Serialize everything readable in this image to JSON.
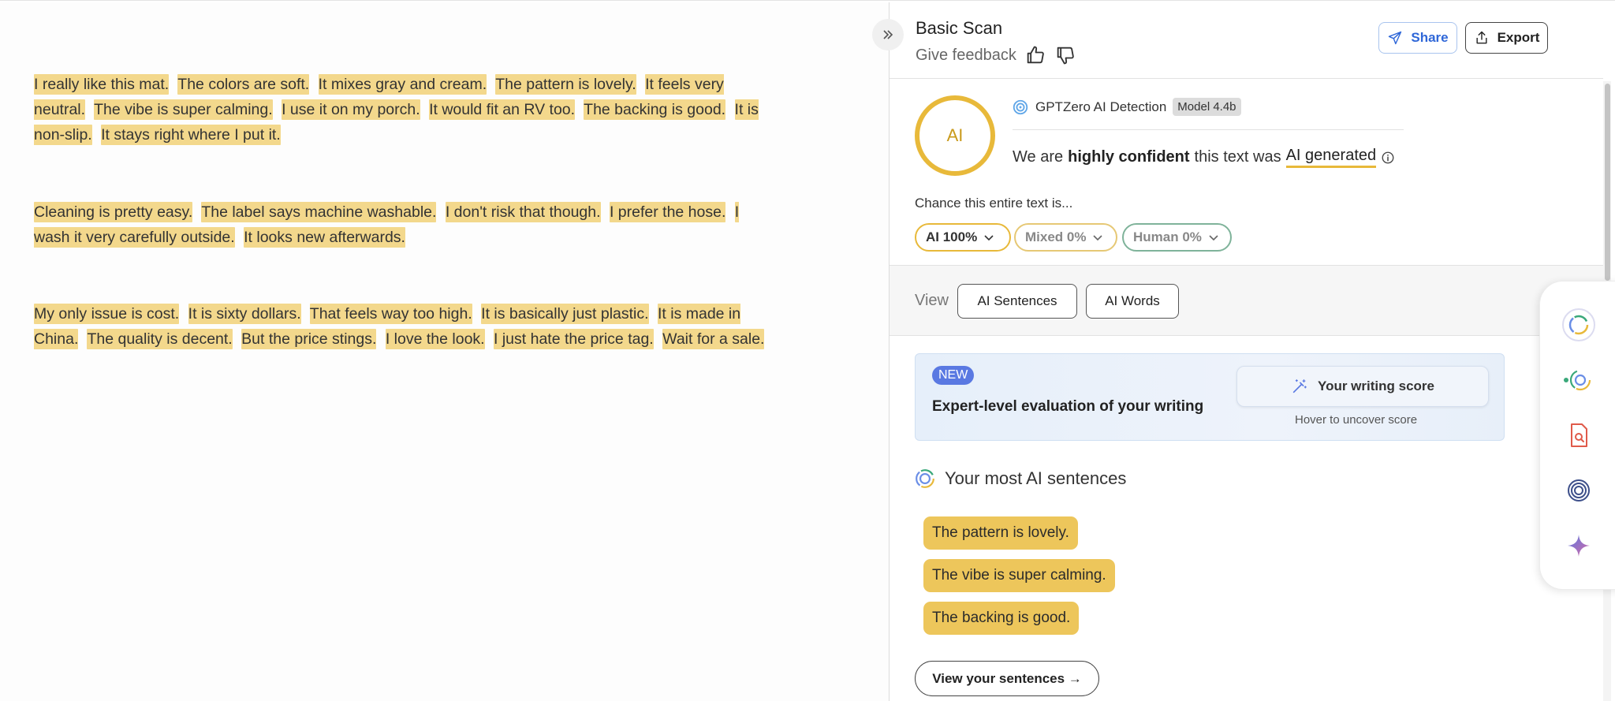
{
  "document": {
    "paragraphs": [
      [
        "I really like this mat.",
        "The colors are soft.",
        "It mixes gray and cream.",
        "The pattern is lovely.",
        "It feels very neutral.",
        "The vibe is super calming.",
        "I use it on my porch.",
        "It would fit an RV too.",
        "The backing is good.",
        "It is non-slip.",
        "It stays right where I put it."
      ],
      [
        "Cleaning is pretty easy.",
        "The label says machine washable.",
        "I don't risk that though.",
        "I prefer the hose.",
        "I wash it very carefully outside.",
        "It looks new afterwards."
      ],
      [
        "My only issue is cost.",
        "It is sixty dollars.",
        "That feels way too high.",
        "It is basically just plastic.",
        "It is made in China.",
        "The quality is decent.",
        "But the price stings.",
        "I love the look.",
        "I just hate the price tag.",
        "Wait for a sale."
      ]
    ],
    "highlight_color": "#f3d88c"
  },
  "header": {
    "title": "Basic Scan",
    "feedback_label": "Give feedback",
    "share_label": "Share",
    "export_label": "Export"
  },
  "detection": {
    "ring_label": "AI",
    "product": "GPTZero AI Detection",
    "model_badge": "Model 4.4b",
    "sentence_prefix": "We are",
    "sentence_bold": "highly confident",
    "sentence_mid": "this text was",
    "sentence_result": "AI generated",
    "chance_label": "Chance this entire text is...",
    "pills": {
      "ai": "AI 100%",
      "mixed": "Mixed 0%",
      "human": "Human 0%"
    },
    "accent_color": "#e8b93a"
  },
  "view": {
    "label": "View",
    "ai_sentences": "AI Sentences",
    "ai_words": "AI Words"
  },
  "promo": {
    "badge": "NEW",
    "text": "Expert-level evaluation of your writing",
    "score_button": "Your writing score",
    "hover_note": "Hover to uncover score"
  },
  "most_ai": {
    "title": "Your most AI sentences",
    "sentences": [
      "The pattern is lovely.",
      "The vibe is super calming.",
      "The backing is good."
    ],
    "view_button": "View your sentences →"
  }
}
